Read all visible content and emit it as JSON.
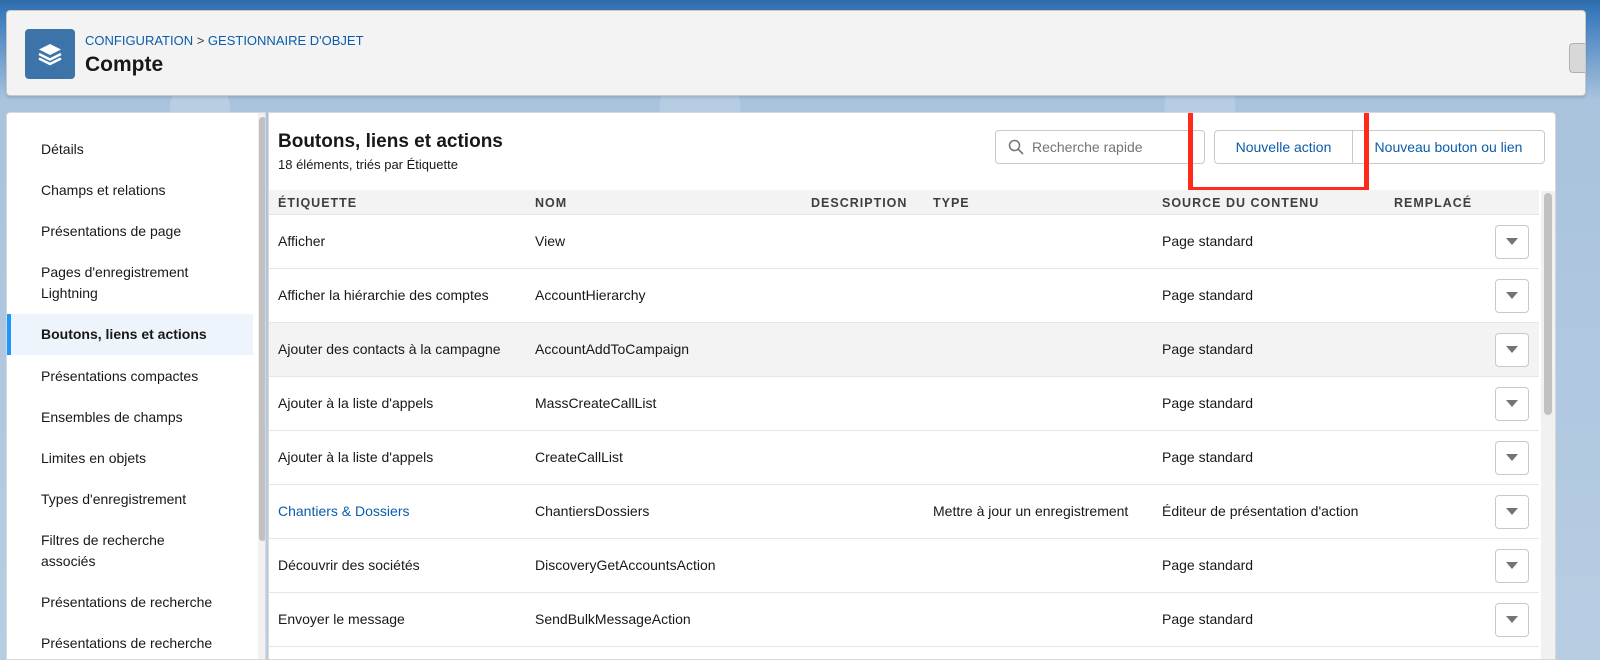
{
  "header": {
    "breadcrumb_1": "CONFIGURATION",
    "breadcrumb_sep": " > ",
    "breadcrumb_2": "GESTIONNAIRE D'OBJET",
    "title": "Compte",
    "icon": "layers-icon",
    "icon_color": "#3c73a8"
  },
  "sidebar": {
    "items": [
      {
        "label": "Détails"
      },
      {
        "label": "Champs et relations"
      },
      {
        "label": "Présentations de page"
      },
      {
        "label": "Pages d'enregistrement Lightning"
      },
      {
        "label": "Boutons, liens et actions"
      },
      {
        "label": "Présentations compactes"
      },
      {
        "label": "Ensembles de champs"
      },
      {
        "label": "Limites en objets"
      },
      {
        "label": "Types d'enregistrement"
      },
      {
        "label": "Filtres de recherche associés"
      },
      {
        "label": "Présentations de recherche"
      },
      {
        "label": "Présentations de recherche"
      }
    ],
    "active_index": 4,
    "accent_color": "#1b96ff"
  },
  "main": {
    "title": "Boutons, liens et actions",
    "subtitle": "18 éléments, triés par Étiquette",
    "search_placeholder": "Recherche rapide",
    "btn_new_action": "Nouvelle action",
    "btn_new_link": "Nouveau bouton ou lien",
    "highlight_color": "#ff2a1a",
    "columns": [
      "Étiquette",
      "Nom",
      "Description",
      "Type",
      "Source du contenu",
      "Remplacé"
    ],
    "rows": [
      {
        "label": "Afficher",
        "name": "View",
        "description": "",
        "type": "",
        "source": "Page standard",
        "overridden": "",
        "link": false
      },
      {
        "label": "Afficher la hiérarchie des comptes",
        "name": "AccountHierarchy",
        "description": "",
        "type": "",
        "source": "Page standard",
        "overridden": "",
        "link": false
      },
      {
        "label": "Ajouter des contacts à la campagne",
        "name": "AccountAddToCampaign",
        "description": "",
        "type": "",
        "source": "Page standard",
        "overridden": "",
        "link": false
      },
      {
        "label": "Ajouter à la liste d'appels",
        "name": "MassCreateCallList",
        "description": "",
        "type": "",
        "source": "Page standard",
        "overridden": "",
        "link": false
      },
      {
        "label": "Ajouter à la liste d'appels",
        "name": "CreateCallList",
        "description": "",
        "type": "",
        "source": "Page standard",
        "overridden": "",
        "link": false
      },
      {
        "label": "Chantiers & Dossiers",
        "name": "ChantiersDossiers",
        "description": "",
        "type": "Mettre à jour un enregistrement",
        "source": "Éditeur de présentation d'action",
        "overridden": "",
        "link": true
      },
      {
        "label": "Découvrir des sociétés",
        "name": "DiscoveryGetAccountsAction",
        "description": "",
        "type": "",
        "source": "Page standard",
        "overridden": "",
        "link": false
      },
      {
        "label": "Envoyer le message",
        "name": "SendBulkMessageAction",
        "description": "",
        "type": "",
        "source": "Page standard",
        "overridden": "",
        "link": false
      }
    ],
    "hover_row_index": 2,
    "link_color": "#0b5cab"
  }
}
